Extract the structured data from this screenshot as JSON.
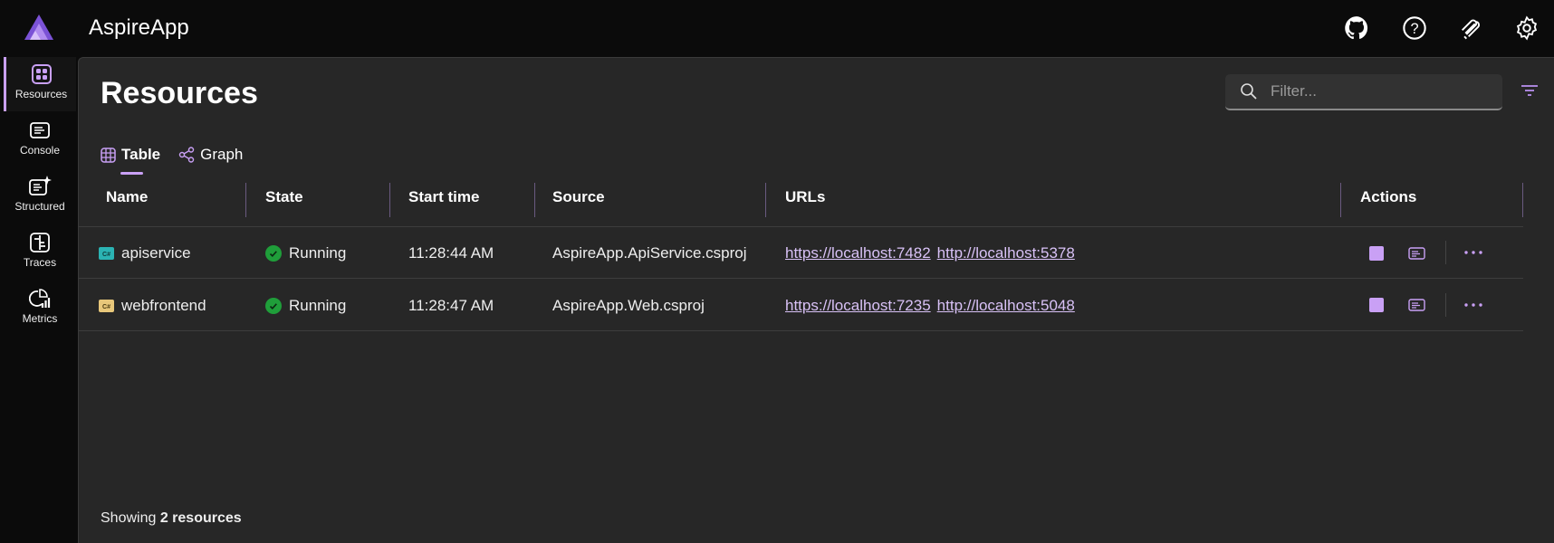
{
  "header": {
    "app_title": "AspireApp",
    "icons": [
      "github-icon",
      "help-icon",
      "docs-icon",
      "settings-icon"
    ]
  },
  "sidebar": {
    "items": [
      {
        "label": "Resources",
        "icon": "resources-icon",
        "active": true
      },
      {
        "label": "Console",
        "icon": "console-icon"
      },
      {
        "label": "Structured",
        "icon": "structured-icon"
      },
      {
        "label": "Traces",
        "icon": "traces-icon"
      },
      {
        "label": "Metrics",
        "icon": "metrics-icon"
      }
    ]
  },
  "main": {
    "title": "Resources",
    "filter_placeholder": "Filter...",
    "tabs": [
      {
        "label": "Table",
        "active": true
      },
      {
        "label": "Graph"
      }
    ]
  },
  "table": {
    "columns": [
      "Name",
      "State",
      "Start time",
      "Source",
      "URLs",
      "Actions"
    ],
    "rows": [
      {
        "name": "apiservice",
        "icon_color": "#2bb3b3",
        "state": "Running",
        "start": "11:28:44 AM",
        "source": "AspireApp.ApiService.csproj",
        "urls": [
          "https://localhost:7482",
          "http://localhost:5378"
        ]
      },
      {
        "name": "webfrontend",
        "icon_color": "#e8c77a",
        "state": "Running",
        "start": "11:28:47 AM",
        "source": "AspireApp.Web.csproj",
        "urls": [
          "https://localhost:7235",
          "http://localhost:5048"
        ]
      }
    ]
  },
  "footer": {
    "prefix": "Showing ",
    "count": "2 resources"
  },
  "colors": {
    "accent": "#c9a0f5",
    "running": "#1f9e3a"
  }
}
